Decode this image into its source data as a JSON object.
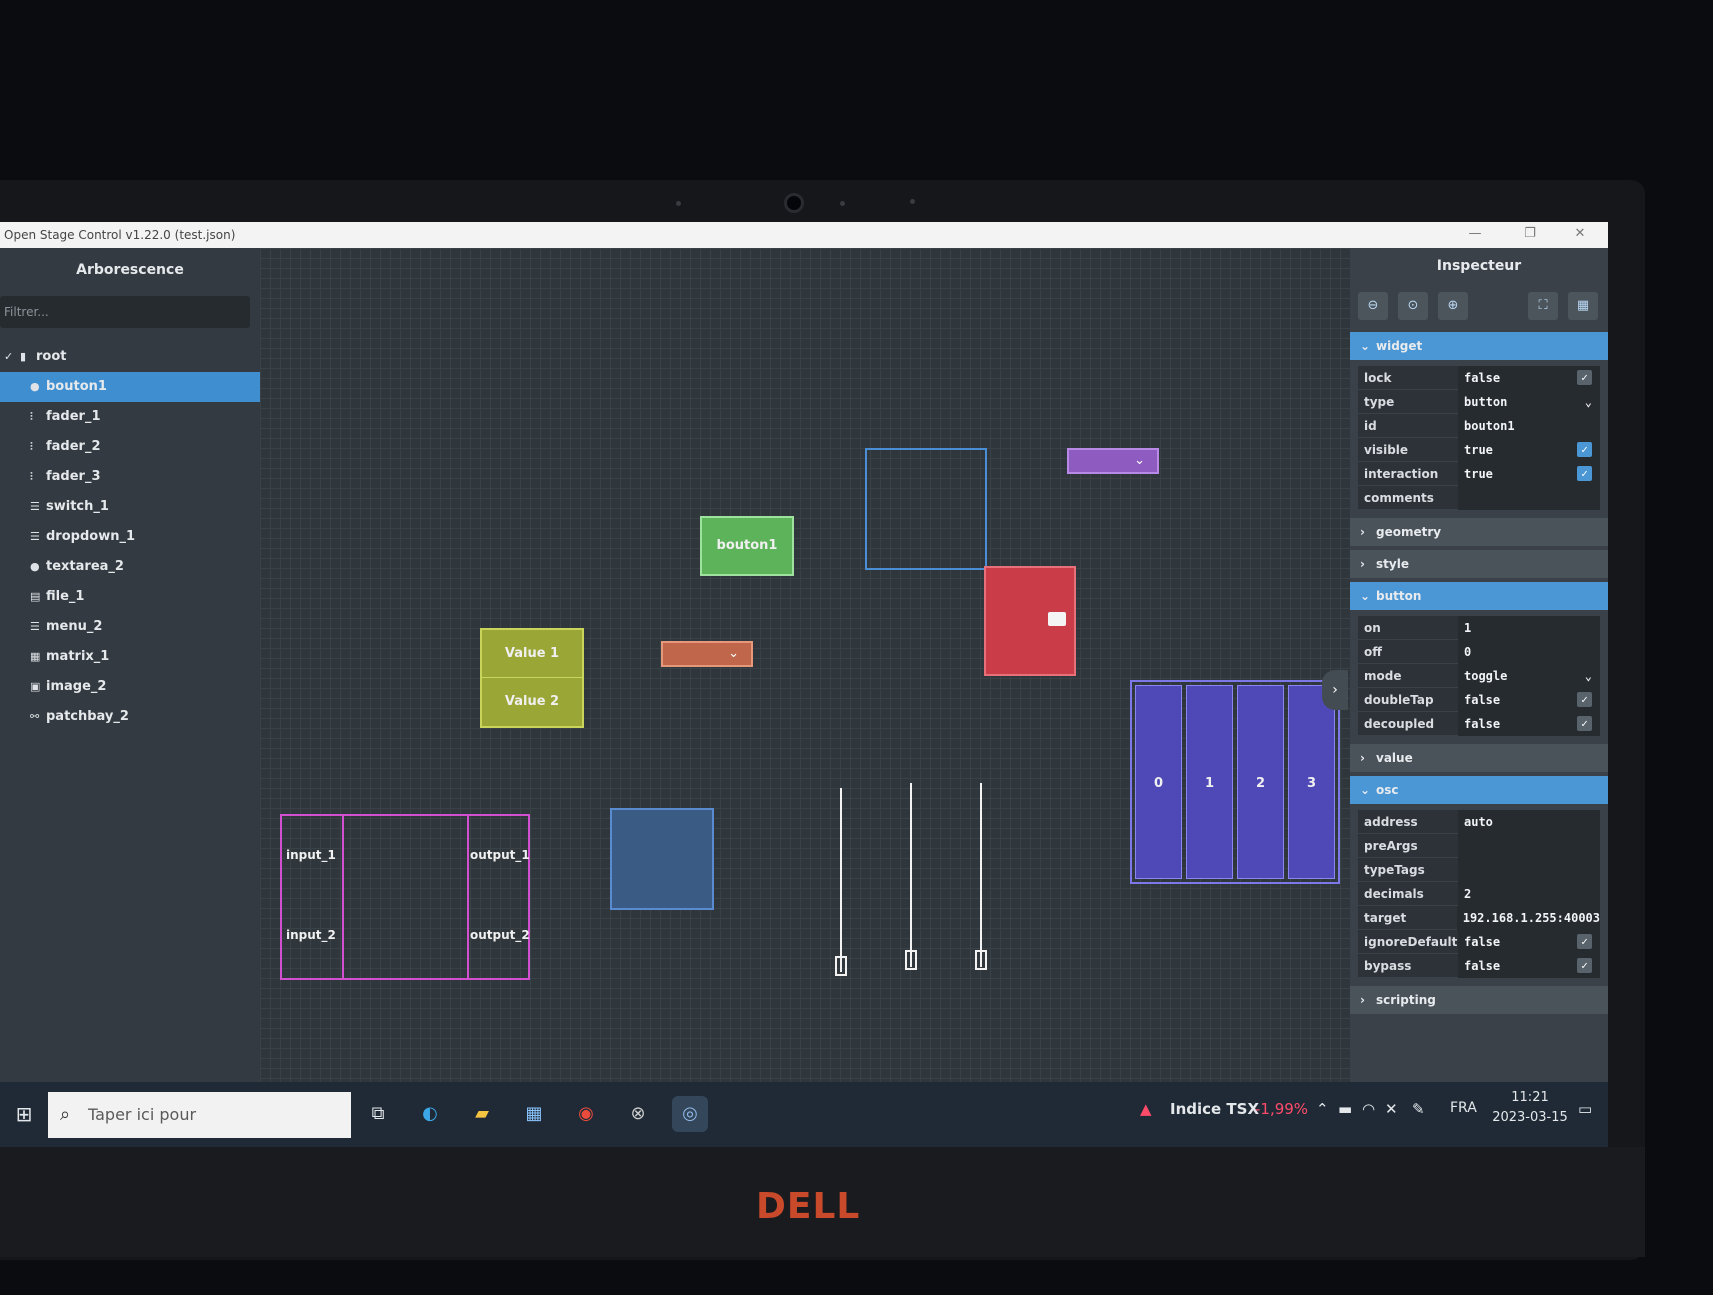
{
  "window": {
    "title": "Open Stage Control v1.22.0 (test.json)",
    "controls": [
      "—",
      "❐",
      "✕"
    ]
  },
  "tree": {
    "header": "Arborescence",
    "filter_placeholder": "Filtrer...",
    "root": "root",
    "items": [
      {
        "label": "bouton1",
        "icon": "toggle-icon"
      },
      {
        "label": "fader_1",
        "icon": "sliders-icon"
      },
      {
        "label": "fader_2",
        "icon": "sliders-icon"
      },
      {
        "label": "fader_3",
        "icon": "sliders-icon"
      },
      {
        "label": "switch_1",
        "icon": "list-icon"
      },
      {
        "label": "dropdown_1",
        "icon": "list-icon"
      },
      {
        "label": "textarea_2",
        "icon": "toggle-icon"
      },
      {
        "label": "file_1",
        "icon": "file-icon"
      },
      {
        "label": "menu_2",
        "icon": "list-icon"
      },
      {
        "label": "matrix_1",
        "icon": "grid-icon"
      },
      {
        "label": "image_2",
        "icon": "image-icon"
      },
      {
        "label": "patchbay_2",
        "icon": "patchbay-icon"
      }
    ]
  },
  "canvas": {
    "button_label": "bouton1",
    "switch_values": [
      "Value 1",
      "Value 2"
    ],
    "matrix_labels": [
      "0",
      "1",
      "2",
      "3"
    ],
    "patchbay": {
      "inputs": [
        "input_1",
        "input_2"
      ],
      "outputs": [
        "output_1",
        "output_2"
      ]
    }
  },
  "inspector": {
    "header": "Inspecteur",
    "toolbar_icons": [
      "zoom-out-icon",
      "zoom-reset-icon",
      "zoom-in-icon",
      "fit-icon",
      "grid-icon"
    ],
    "sections": {
      "widget": "widget",
      "geometry": "geometry",
      "style": "style",
      "button": "button",
      "value": "value",
      "osc": "osc",
      "scripting": "scripting"
    },
    "widget_props": [
      {
        "key": "lock",
        "value": "false",
        "control": "check",
        "checked": false
      },
      {
        "key": "type",
        "value": "button",
        "control": "dropdown"
      },
      {
        "key": "id",
        "value": "bouton1",
        "control": "text"
      },
      {
        "key": "visible",
        "value": "true",
        "control": "check",
        "checked": true
      },
      {
        "key": "interaction",
        "value": "true",
        "control": "check",
        "checked": true
      },
      {
        "key": "comments",
        "value": "",
        "control": "text"
      }
    ],
    "button_props": [
      {
        "key": "on",
        "value": "1",
        "control": "text"
      },
      {
        "key": "off",
        "value": "0",
        "control": "text"
      },
      {
        "key": "mode",
        "value": "toggle",
        "control": "dropdown"
      },
      {
        "key": "doubleTap",
        "value": "false",
        "control": "check",
        "checked": false
      },
      {
        "key": "decoupled",
        "value": "false",
        "control": "check",
        "checked": false
      }
    ],
    "osc_props": [
      {
        "key": "address",
        "value": "auto",
        "control": "text"
      },
      {
        "key": "preArgs",
        "value": "",
        "control": "text"
      },
      {
        "key": "typeTags",
        "value": "",
        "control": "text"
      },
      {
        "key": "decimals",
        "value": "2",
        "control": "text"
      },
      {
        "key": "target",
        "value": "192.168.1.255:40003",
        "control": "text"
      },
      {
        "key": "ignoreDefaults",
        "value": "false",
        "control": "check",
        "checked": false
      },
      {
        "key": "bypass",
        "value": "false",
        "control": "check",
        "checked": false
      }
    ]
  },
  "taskbar": {
    "search_placeholder": "Taper ici pour",
    "stock_name": "Indice TSX",
    "stock_change": "-1,99%",
    "language": "FRA",
    "time": "11:21",
    "date": "2023-03-15"
  },
  "device": {
    "brand": "DELL"
  },
  "colors": {
    "accent": "#4b96d4",
    "button_widget": "#5db35a",
    "switch_widget": "#9aa635",
    "dropdown_orange": "#c0664b",
    "file_red": "#c93c48",
    "matrix_purple": "#4f49b8",
    "patchbay_pink": "#d24fd0",
    "stock_negative": "#ff4b6a"
  }
}
